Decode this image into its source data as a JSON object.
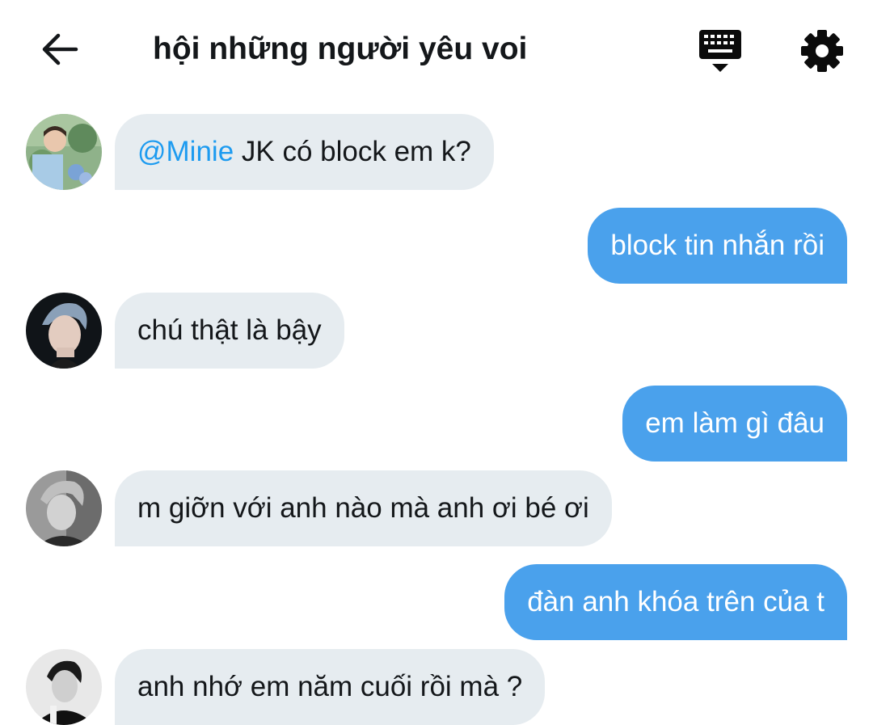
{
  "header": {
    "title": "hội những người yêu voi",
    "back_icon": "arrow-left-icon",
    "keyboard_icon": "keyboard-icon",
    "settings_icon": "gear-icon"
  },
  "colors": {
    "incoming_bubble": "#e6ecf0",
    "outgoing_bubble": "#4aa1ec",
    "mention": "#1d9bf0",
    "text": "#14171a"
  },
  "messages": [
    {
      "direction": "in",
      "mention": "@Minie",
      "text": " JK có block em k?"
    },
    {
      "direction": "out",
      "text": "block tin nhắn rồi"
    },
    {
      "direction": "in",
      "text": "chú thật là bậy"
    },
    {
      "direction": "out",
      "text": "em làm gì đâu"
    },
    {
      "direction": "in",
      "text": "m giỡn với anh nào mà anh ơi bé ơi"
    },
    {
      "direction": "out",
      "text": "đàn anh khóa trên của t"
    },
    {
      "direction": "in",
      "text": "anh nhớ em năm cuối rồi mà ?"
    }
  ]
}
